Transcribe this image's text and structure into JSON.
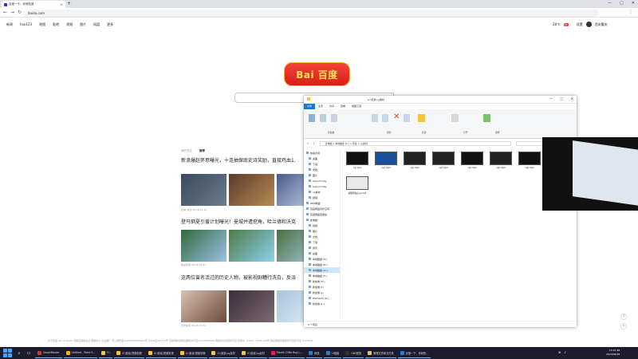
{
  "browser": {
    "tab_title": "百度一下，你就知道",
    "address": "baidu.com"
  },
  "baidu": {
    "nav": [
      "新闻",
      "hao123",
      "地图",
      "贴吧",
      "视频",
      "图片",
      "网盘",
      "更多"
    ],
    "weather_temp": "28℃",
    "weather_badge": "优",
    "settings": "设置",
    "user": "西安重庆",
    "logo_text": "Bai 百度",
    "feed_tabs": [
      "我的关注",
      "推荐"
    ],
    "feed": [
      {
        "title": "新浪爆赵怀意曝光，十连抽保底史诗奖励，直接鸡血1,",
        "meta": "原神-游戏  06-28 12:36"
      },
      {
        "title": "登马钢夏引援计划曝光！曼城并遭挖角，哈兰德和沃克",
        "meta": "我是足球  06-28 12:51"
      },
      {
        "title": "这两位曾名活过的历史人物，被影视剧糟行洗白，反派",
        "meta": "历史秘闻  06-28 11:42"
      }
    ],
    "footer": "关于百度   About Baidu   使用百度前必读   帮助中心   企业推广   京公网安备11000002000001号   京ICP证030173号   互联网新闻信息服务许可证11220180008   网络文化经营许可证 京网文〔2023〕1034-029号   信息网络传播视听节目许可证 0110516"
  },
  "explorer": {
    "title": "G:\\原素\\cg素材",
    "ribbon_tabs": [
      "文件",
      "主页",
      "共享",
      "查看",
      "视频工具"
    ],
    "ribbon_groups": [
      "剪贴板",
      "组织",
      "新建",
      "打开",
      "选择"
    ],
    "path": "此电脑  >  本地磁盘 (G:)  >  原素  >  cg素材",
    "nav_items": [
      {
        "label": "快速访问",
        "group": true
      },
      {
        "label": "桌面"
      },
      {
        "label": "下载"
      },
      {
        "label": "文档"
      },
      {
        "label": "图片"
      },
      {
        "label": "Call of Duty"
      },
      {
        "label": "Call of Duty"
      },
      {
        "label": "cg素材"
      },
      {
        "label": "视频"
      },
      {
        "label": "WPS网盘",
        "group": true
      },
      {
        "label": "百度网盘同步空间",
        "group": true
      },
      {
        "label": "百度网盘回收站",
        "group": true
      },
      {
        "label": "此电脑",
        "group": true
      },
      {
        "label": "视频"
      },
      {
        "label": "图片"
      },
      {
        "label": "文档"
      },
      {
        "label": "下载"
      },
      {
        "label": "音乐"
      },
      {
        "label": "桌面"
      },
      {
        "label": "本地磁盘 (C:)"
      },
      {
        "label": "本地磁盘 (D:)"
      },
      {
        "label": "本地磁盘 (G:)",
        "selected": true
      },
      {
        "label": "本地磁盘 (F:)"
      },
      {
        "label": "新加卷 (H:)"
      },
      {
        "label": "新加卷 (I:)"
      },
      {
        "label": "新加卷 (J:)"
      },
      {
        "label": "Elements (K:)"
      },
      {
        "label": "新加卷 (L:)"
      }
    ],
    "files": [
      "cg.mp4",
      "cg1.mp4",
      "cg2.mp4",
      "cg3.mp4",
      "cg4.mp4",
      "cg5.mp4",
      "cg6.mp4",
      "cg7.mp4",
      "缩略剪辑后cg.mp4"
    ],
    "status": "9 个项目"
  },
  "taskbar": {
    "apps": [
      "SmartMaster",
      "Untitled - Paint S...",
      "E:\\",
      "E:\\原素\\视频剪辑",
      "G:\\原素\\视频剪辑",
      "G:\\原素\\视频剪辑",
      "G:\\原素\\cg素材",
      "G:\\原素\\cg素材",
      "Month Cliffe Bug L...",
      "网易",
      "Ui组装",
      "OBS回放",
      "管理文件和文件夹",
      "百度一下，你就知..."
    ],
    "time": "15:07:48",
    "date": "2023/06/28"
  },
  "colors": {
    "accent": "#2932e1",
    "baidu_red": "#f73131",
    "explorer_blue": "#1979ca",
    "taskbar": "#1c1c2c"
  }
}
